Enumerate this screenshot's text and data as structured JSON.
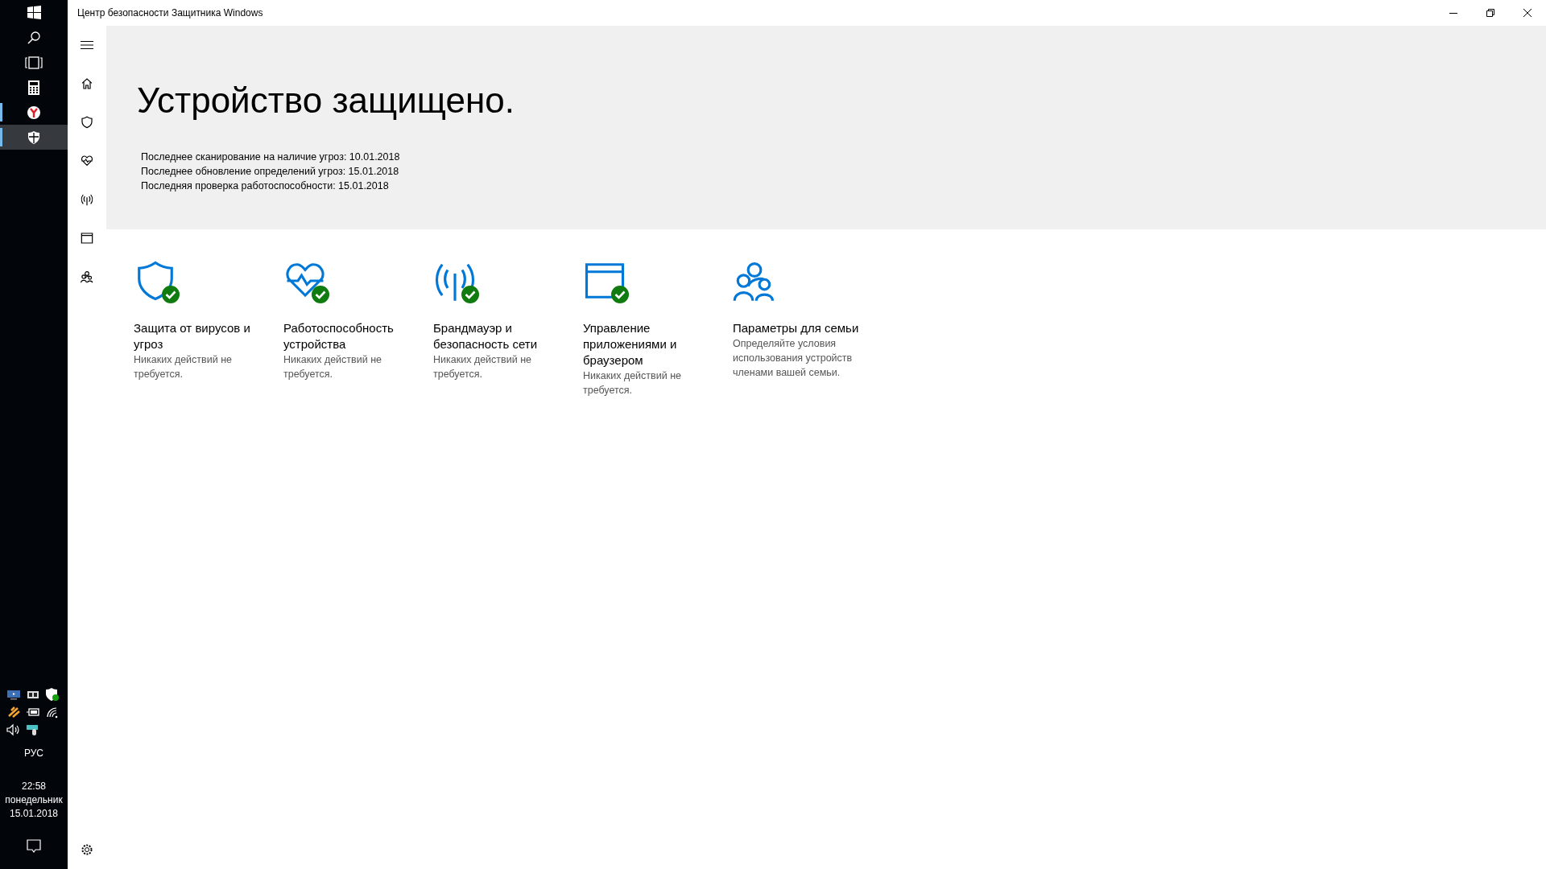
{
  "taskbar": {
    "apps": [
      {
        "kind": "calculator",
        "running": false,
        "selected": false
      },
      {
        "kind": "browser",
        "running": true,
        "selected": false
      },
      {
        "kind": "shield",
        "running": true,
        "selected": true
      }
    ],
    "language": "РУС",
    "time": "22:58",
    "weekday": "понедельник",
    "date": "15.01.2018"
  },
  "window": {
    "title": "Центр безопасности Защитника Windows"
  },
  "nav": [
    {
      "kind": "home"
    },
    {
      "kind": "shield"
    },
    {
      "kind": "health"
    },
    {
      "kind": "network"
    },
    {
      "kind": "app"
    },
    {
      "kind": "family"
    }
  ],
  "header": {
    "title": "Устройство защищено.",
    "lines": [
      "Последнее сканирование на наличие угроз: 10.01.2018",
      "Последнее обновление определений угроз: 15.01.2018",
      "Последняя проверка работоспособности: 15.01.2018"
    ]
  },
  "cards": [
    {
      "kind": "shield",
      "title": "Защита от вирусов и угроз",
      "subtitle": "Никаких действий не требуется.",
      "ok": true
    },
    {
      "kind": "health",
      "title": "Работоспособность устройства",
      "subtitle": "Никаких действий не требуется.",
      "ok": true
    },
    {
      "kind": "network",
      "title": "Брандмауэр и безопасность сети",
      "subtitle": "Никаких действий не требуется.",
      "ok": true
    },
    {
      "kind": "app",
      "title": "Управление приложениями и браузером",
      "subtitle": "Никаких действий не требуется.",
      "ok": true
    },
    {
      "kind": "family",
      "title": "Параметры для семьи",
      "subtitle": "Определяйте условия использования устройств членами вашей семьи.",
      "ok": false
    }
  ]
}
